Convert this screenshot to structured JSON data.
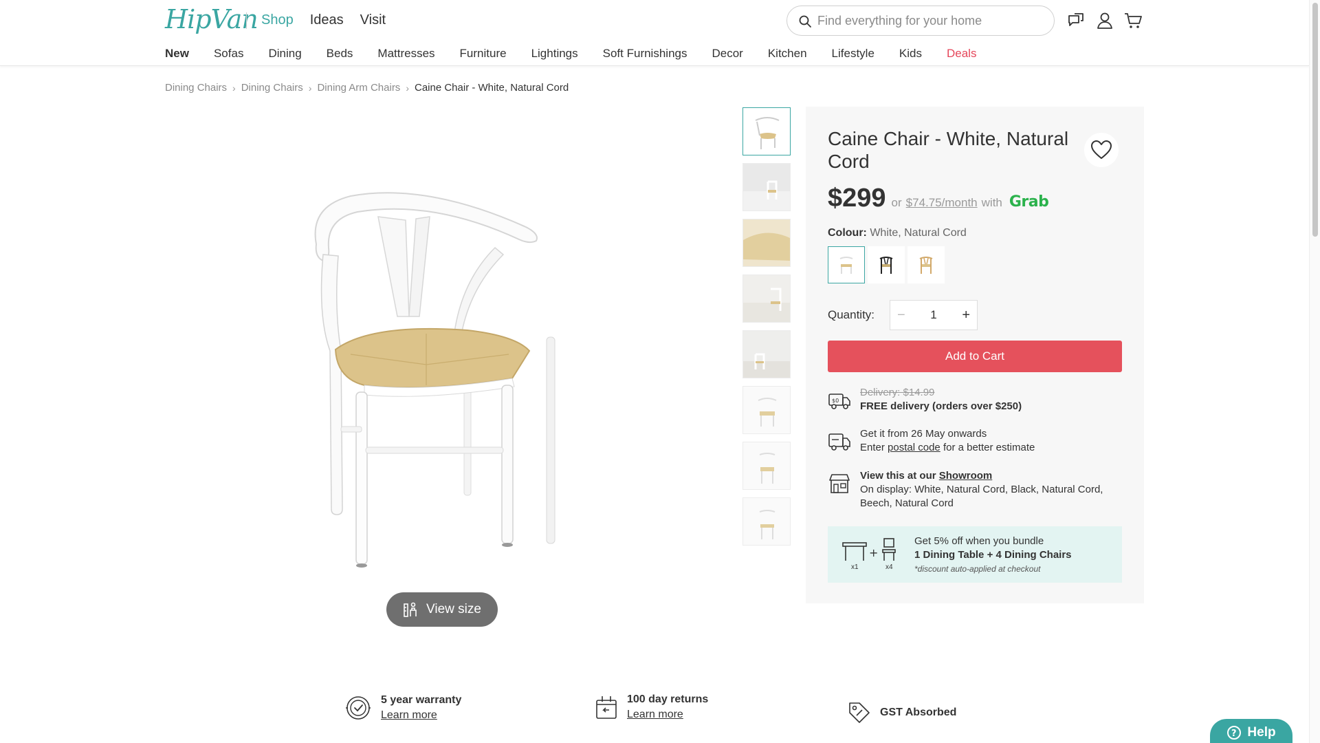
{
  "header": {
    "logo": "HipVan",
    "topnav": [
      "Shop",
      "Ideas",
      "Visit"
    ],
    "search_placeholder": "Find everything for your home"
  },
  "categories": [
    "New",
    "Sofas",
    "Dining",
    "Beds",
    "Mattresses",
    "Furniture",
    "Lightings",
    "Soft Furnishings",
    "Decor",
    "Kitchen",
    "Lifestyle",
    "Kids",
    "Deals"
  ],
  "breadcrumb": [
    "Dining Chairs",
    "Dining Chairs",
    "Dining Arm Chairs",
    "Caine Chair - White, Natural Cord"
  ],
  "product": {
    "title": "Caine Chair - White, Natural Cord",
    "price": "$299",
    "price_or": "or",
    "monthly": "$74.75/month",
    "with": "with",
    "grab": "Grab",
    "colour_label": "Colour:",
    "colour_value": "White, Natural Cord",
    "quantity_label": "Quantity:",
    "quantity": "1",
    "add_to_cart": "Add to Cart",
    "view_size": "View size"
  },
  "delivery": {
    "old": "Delivery: $14.99",
    "free": "FREE delivery (orders over $250)",
    "eta": "Get it from 26 May onwards",
    "enter": "Enter",
    "postal": "postal code",
    "estimate": "for a better estimate",
    "view_at": "View this at our",
    "showroom": "Showroom",
    "display": "On display: White, Natural Cord, Black, Natural Cord, Beech, Natural Cord"
  },
  "bundle": {
    "line1": "Get 5% off when you bundle",
    "line2": "1 Dining Table + 4 Dining Chairs",
    "note": "*discount auto-applied at checkout",
    "x1": "x1",
    "x4": "x4"
  },
  "features": [
    {
      "title": "5 year warranty",
      "link": "Learn more"
    },
    {
      "title": "100 day returns",
      "link": "Learn more"
    },
    {
      "title": "GST Absorbed",
      "link": ""
    }
  ],
  "help": "Help",
  "colors": {
    "accent": "#3aa6a2",
    "cta": "#e5515c",
    "deals": "#e5465a",
    "grab": "#2bb24c"
  }
}
